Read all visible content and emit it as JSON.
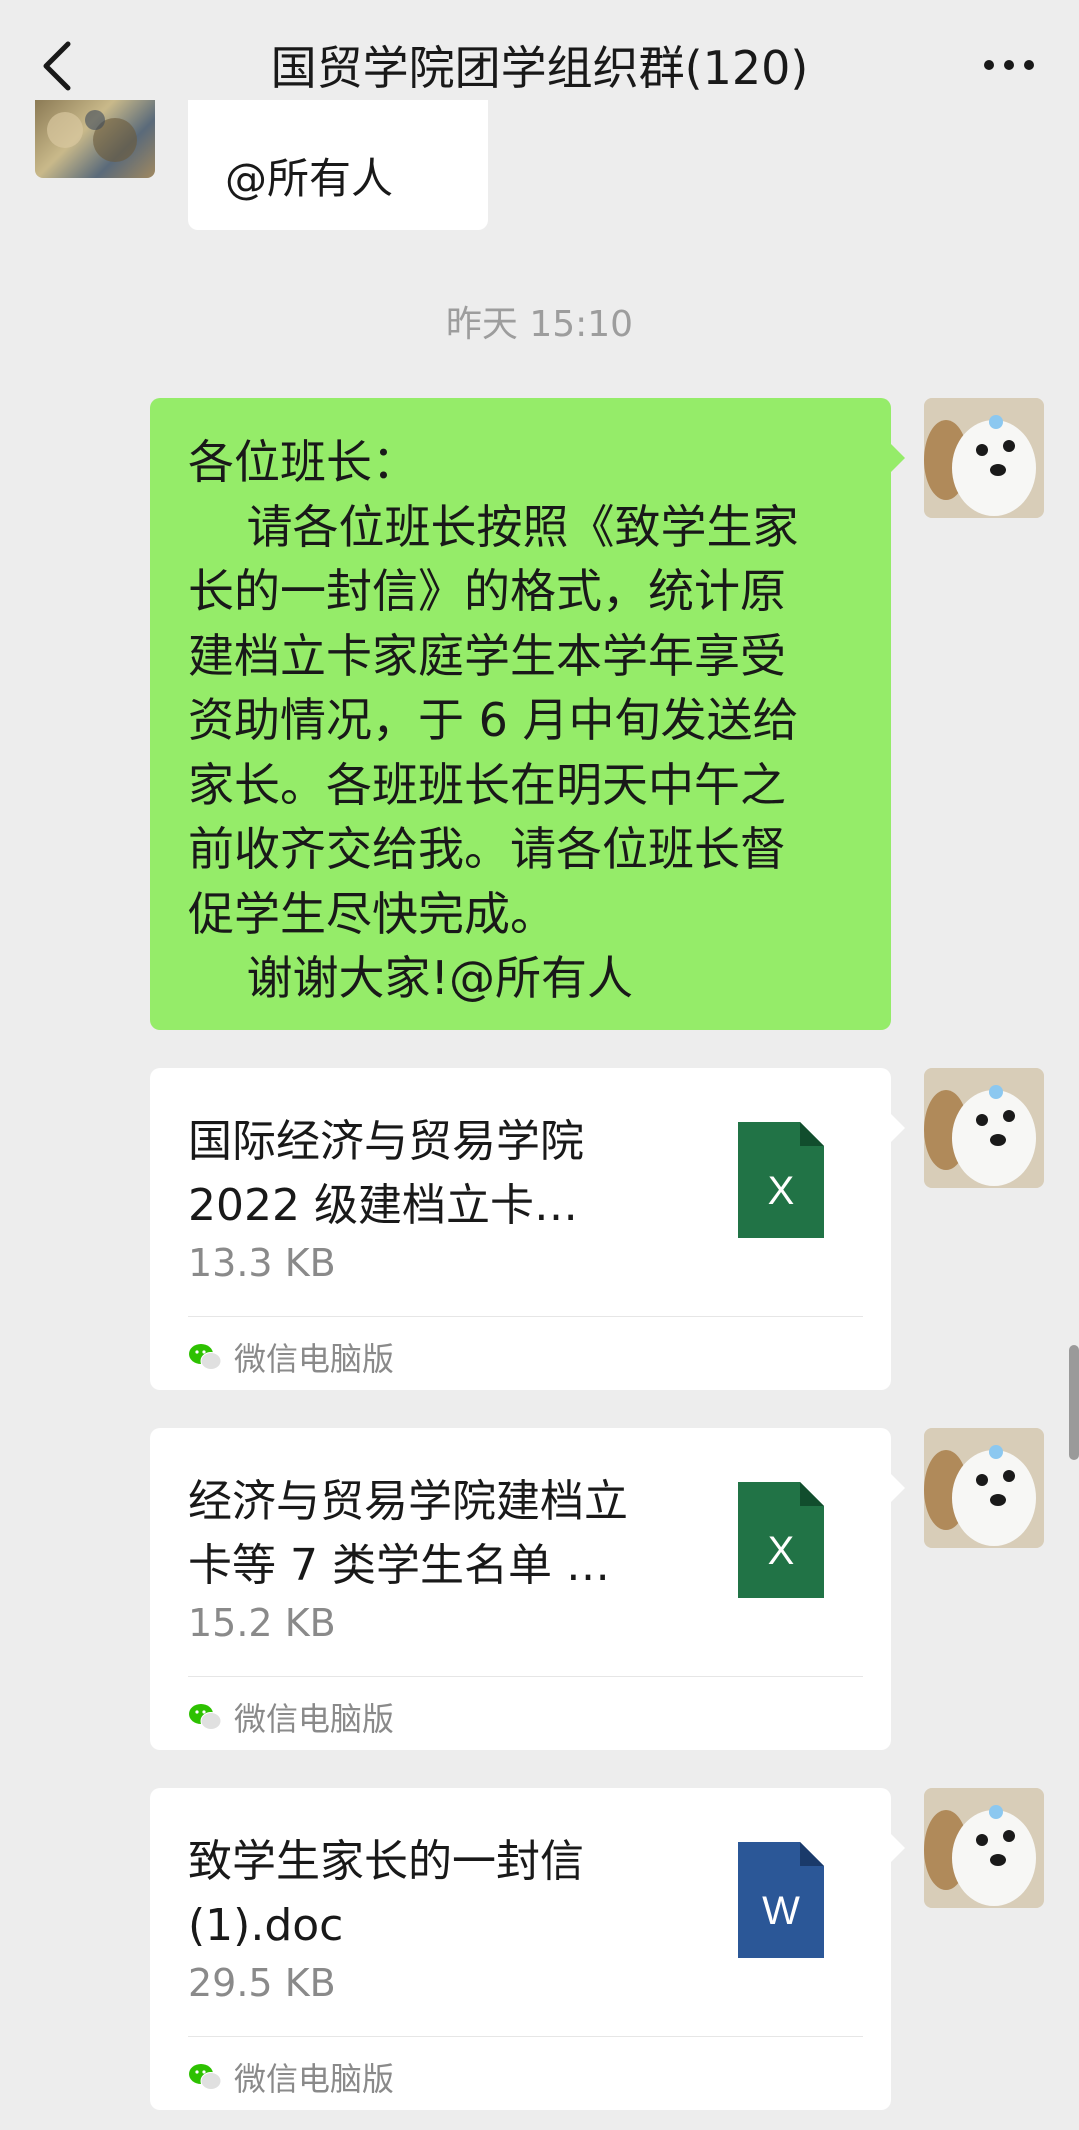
{
  "header": {
    "title": "国贸学院团学组织群(120)",
    "back_icon": "chevron-left-icon",
    "more_icon": "more-icon"
  },
  "prev_message": {
    "text": "@所有人"
  },
  "timestamp": "昨天 15:10",
  "text_message": {
    "lines": [
      "各位班长：",
      "    请各位班长按照《致学生家",
      "长的一封信》的格式，统计原",
      "建档立卡家庭学生本学年享受",
      "资助情况，于 6 月中旬发送给",
      "家长。各班班长在明天中午之",
      "前收齐交给我。请各位班长督",
      "促学生尽快完成。",
      "    谢谢大家!@所有人"
    ]
  },
  "files": [
    {
      "name_line1": "国际经济与贸易学院",
      "name_line2": "2022 级建档立卡…",
      "size": "13.3 KB",
      "source": "微信电脑版",
      "icon_letter": "X",
      "icon_color": "#217346"
    },
    {
      "name_line1": "经济与贸易学院建档立",
      "name_line2": "卡等 7 类学生名单 …",
      "size": "15.2 KB",
      "source": "微信电脑版",
      "icon_letter": "X",
      "icon_color": "#217346"
    },
    {
      "name_line1": "致学生家长的一封信",
      "name_line2": "(1).doc",
      "size": "29.5 KB",
      "source": "微信电脑版",
      "icon_letter": "W",
      "icon_color": "#2b5797"
    }
  ],
  "colors": {
    "background": "#ededed",
    "bubble_green": "#95ec69",
    "bubble_white": "#ffffff"
  }
}
